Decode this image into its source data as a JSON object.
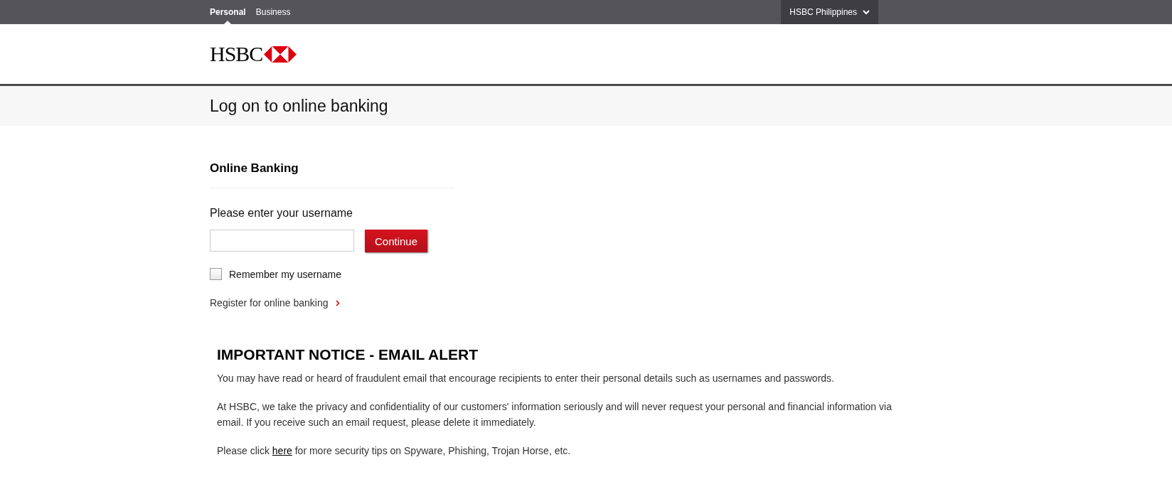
{
  "top_nav": {
    "tabs": [
      {
        "label": "Personal",
        "selected": true
      },
      {
        "label": "Business",
        "selected": false
      }
    ],
    "region": "HSBC Philippines"
  },
  "logo": {
    "text": "HSBC"
  },
  "page_title": "Log on to online banking",
  "form": {
    "heading": "Online Banking",
    "label": "Please enter your username",
    "button": "Continue",
    "remember": {
      "label": "Remember my username",
      "checked": false
    },
    "register_link": "Register for online banking"
  },
  "notice": {
    "heading": "IMPORTANT NOTICE - EMAIL ALERT",
    "paragraphs": [
      {
        "text": "You may have read or heard of fraudulent email that encourage recipients to enter their personal details such as usernames and passwords."
      },
      {
        "text": "At HSBC, we take the privacy and confidentiality of our customers' information seriously and will never request your personal and financial information via email. If you receive such an email request, please delete it immediately."
      },
      {
        "before": "Please click ",
        "link": "here",
        "after": " for more security tips on Spyware, Phishing, Trojan Horse, etc."
      }
    ]
  }
}
